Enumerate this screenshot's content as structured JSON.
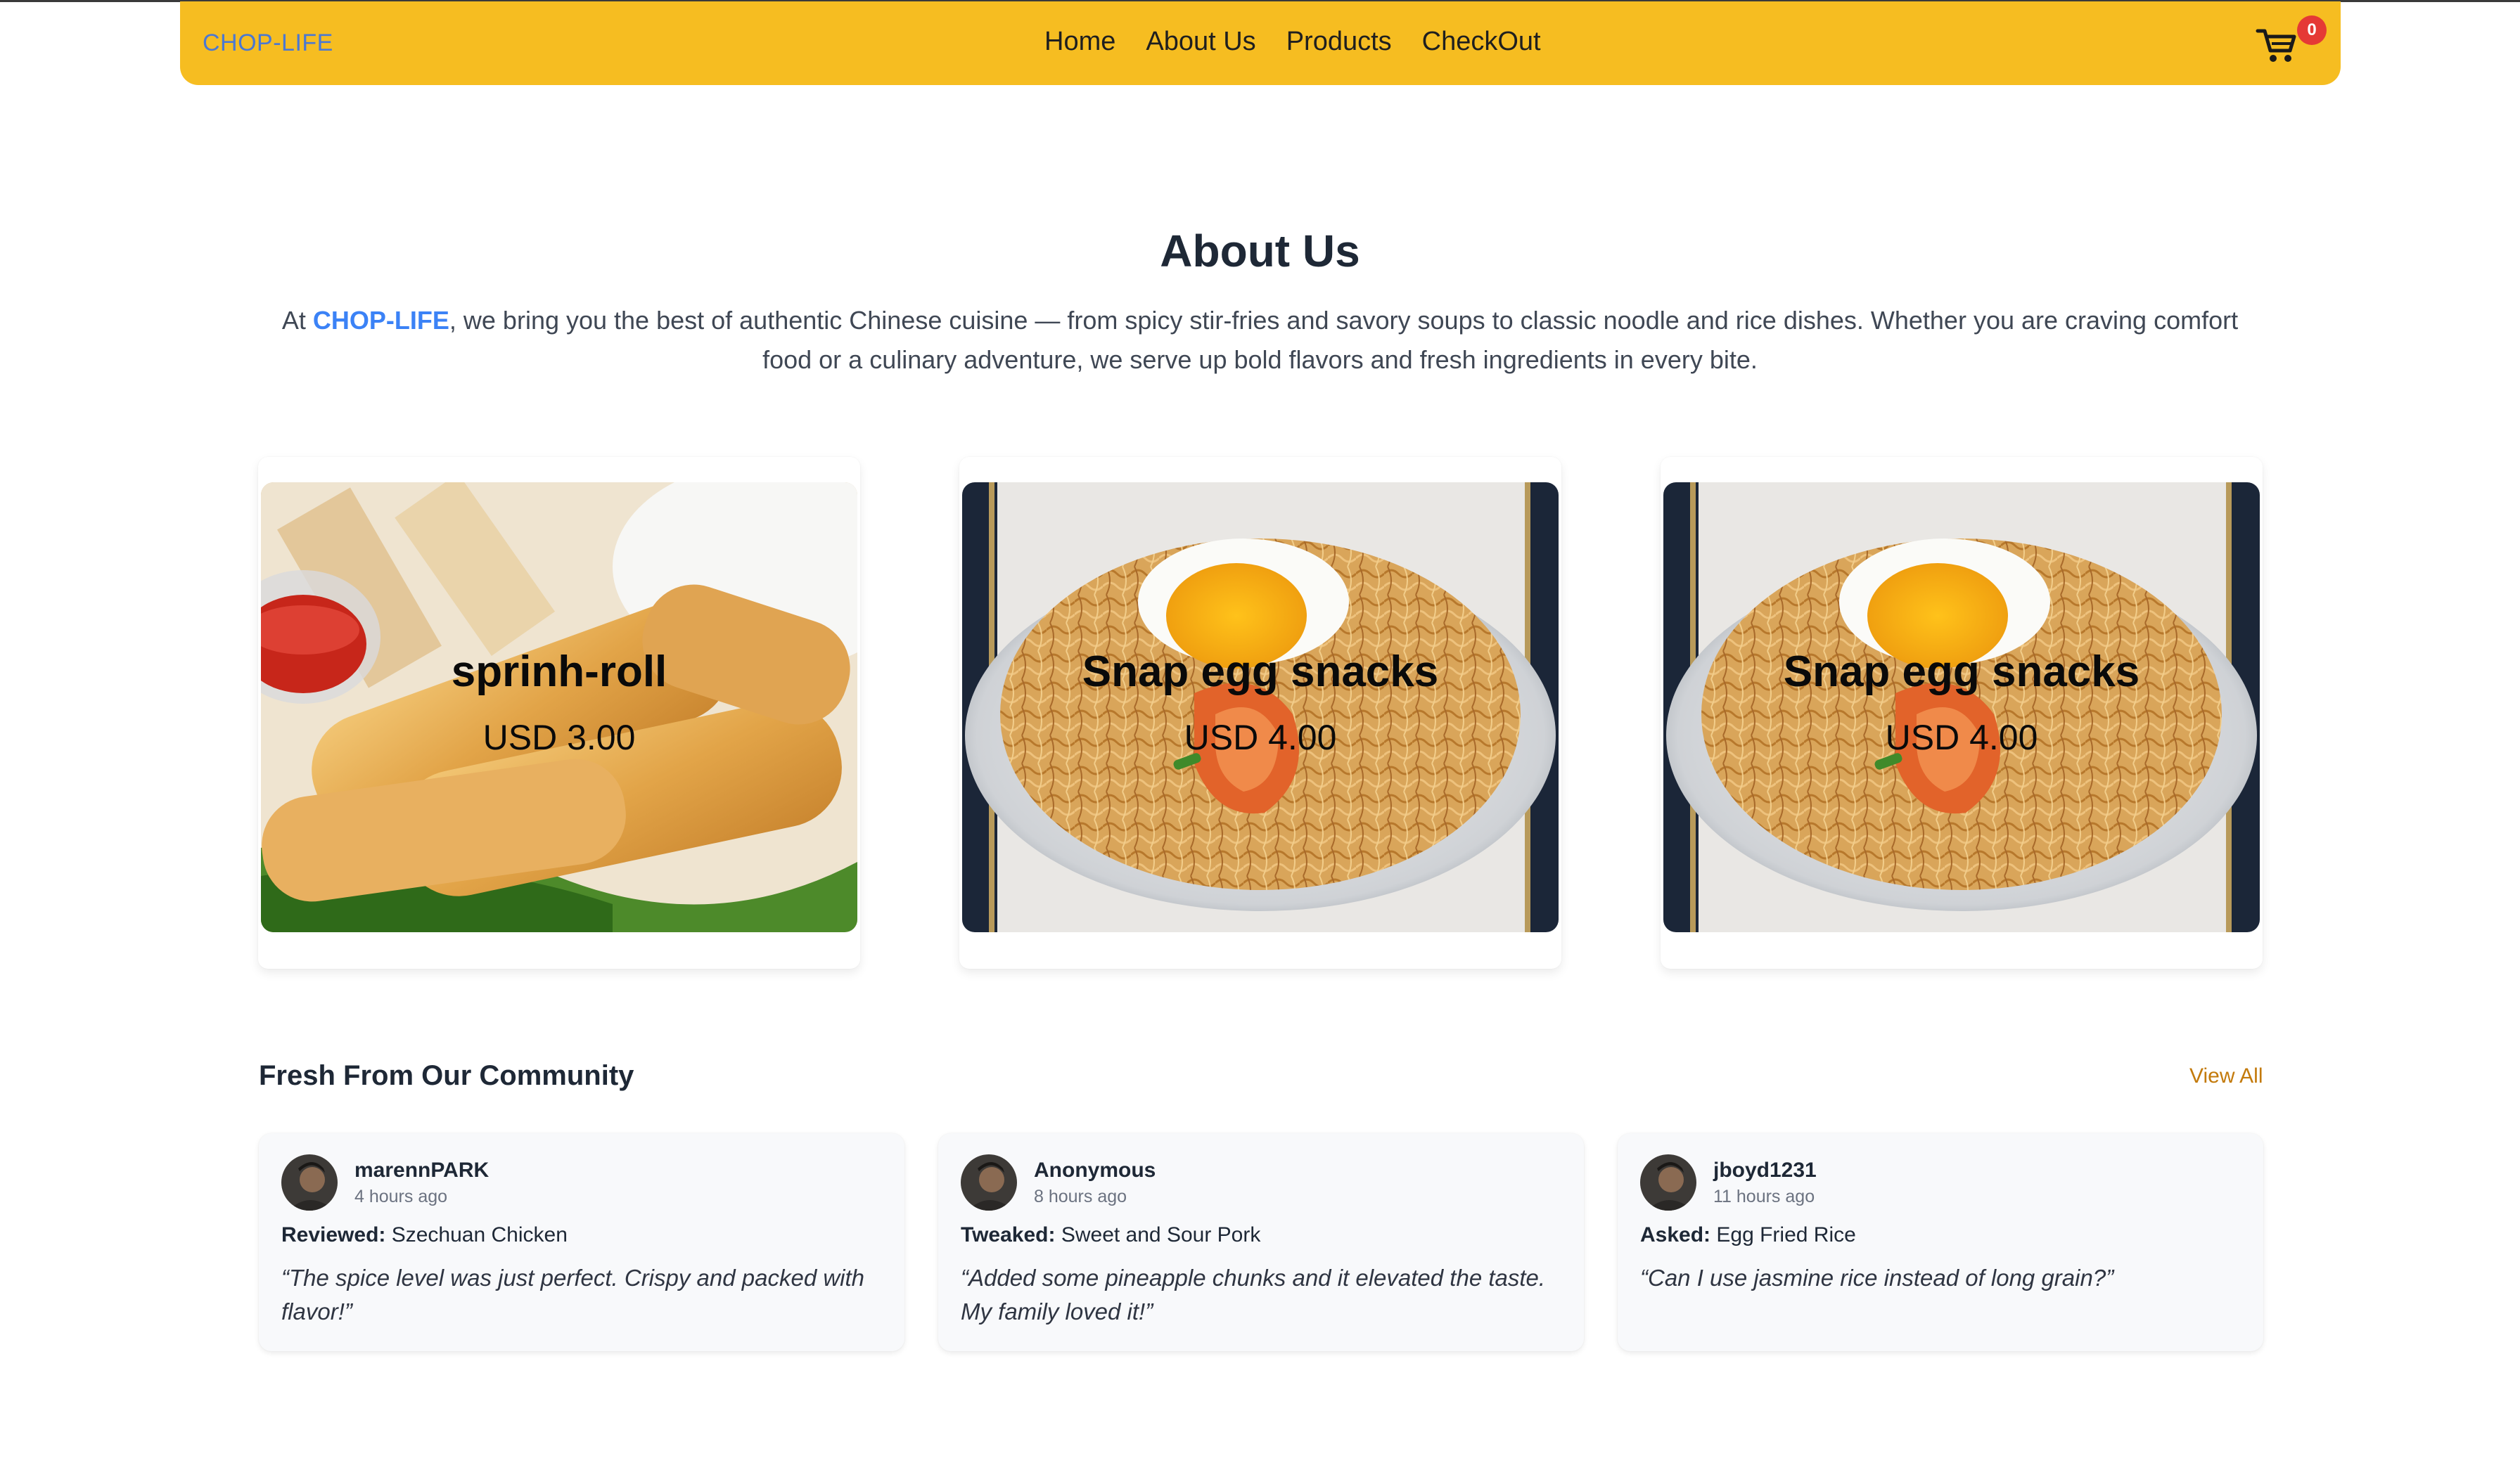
{
  "navbar": {
    "brand": "CHOP-LIFE",
    "links": [
      "Home",
      "About Us",
      "Products",
      "CheckOut"
    ],
    "cart_count": "0",
    "bg_color": "#f6bd21"
  },
  "about": {
    "title": "About Us",
    "text_prefix": "At ",
    "brand_highlight": "CHOP-LIFE",
    "text_suffix": ", we bring you the best of authentic Chinese cuisine — from spicy stir-fries and savory soups to classic noodle and rice dishes. Whether you are craving comfort food or a culinary adventure, we serve up bold flavors and fresh ingredients in every bite."
  },
  "products": [
    {
      "name": "sprinh-roll",
      "price": "USD 3.00",
      "image": "spring-roll-photo"
    },
    {
      "name": "Snap egg snacks",
      "price": "USD 4.00",
      "image": "egg-noodle-photo"
    },
    {
      "name": "Snap egg snacks",
      "price": "USD 4.00",
      "image": "egg-noodle-photo"
    }
  ],
  "community": {
    "title": "Fresh From Our Community",
    "view_all": "View All",
    "posts": [
      {
        "user": "marennPARK",
        "time": "4 hours ago",
        "verb": "Reviewed:",
        "item": "Szechuan Chicken",
        "quote": "“The spice level was just perfect. Crispy and packed with flavor!”"
      },
      {
        "user": "Anonymous",
        "time": "8 hours ago",
        "verb": "Tweaked:",
        "item": "Sweet and Sour Pork",
        "quote": "“Added some pineapple chunks and it elevated the taste. My family loved it!”"
      },
      {
        "user": "jboyd1231",
        "time": "11 hours ago",
        "verb": "Asked:",
        "item": "Egg Fried Rice",
        "quote": "“Can I use jasmine rice instead of long grain?”"
      }
    ]
  }
}
